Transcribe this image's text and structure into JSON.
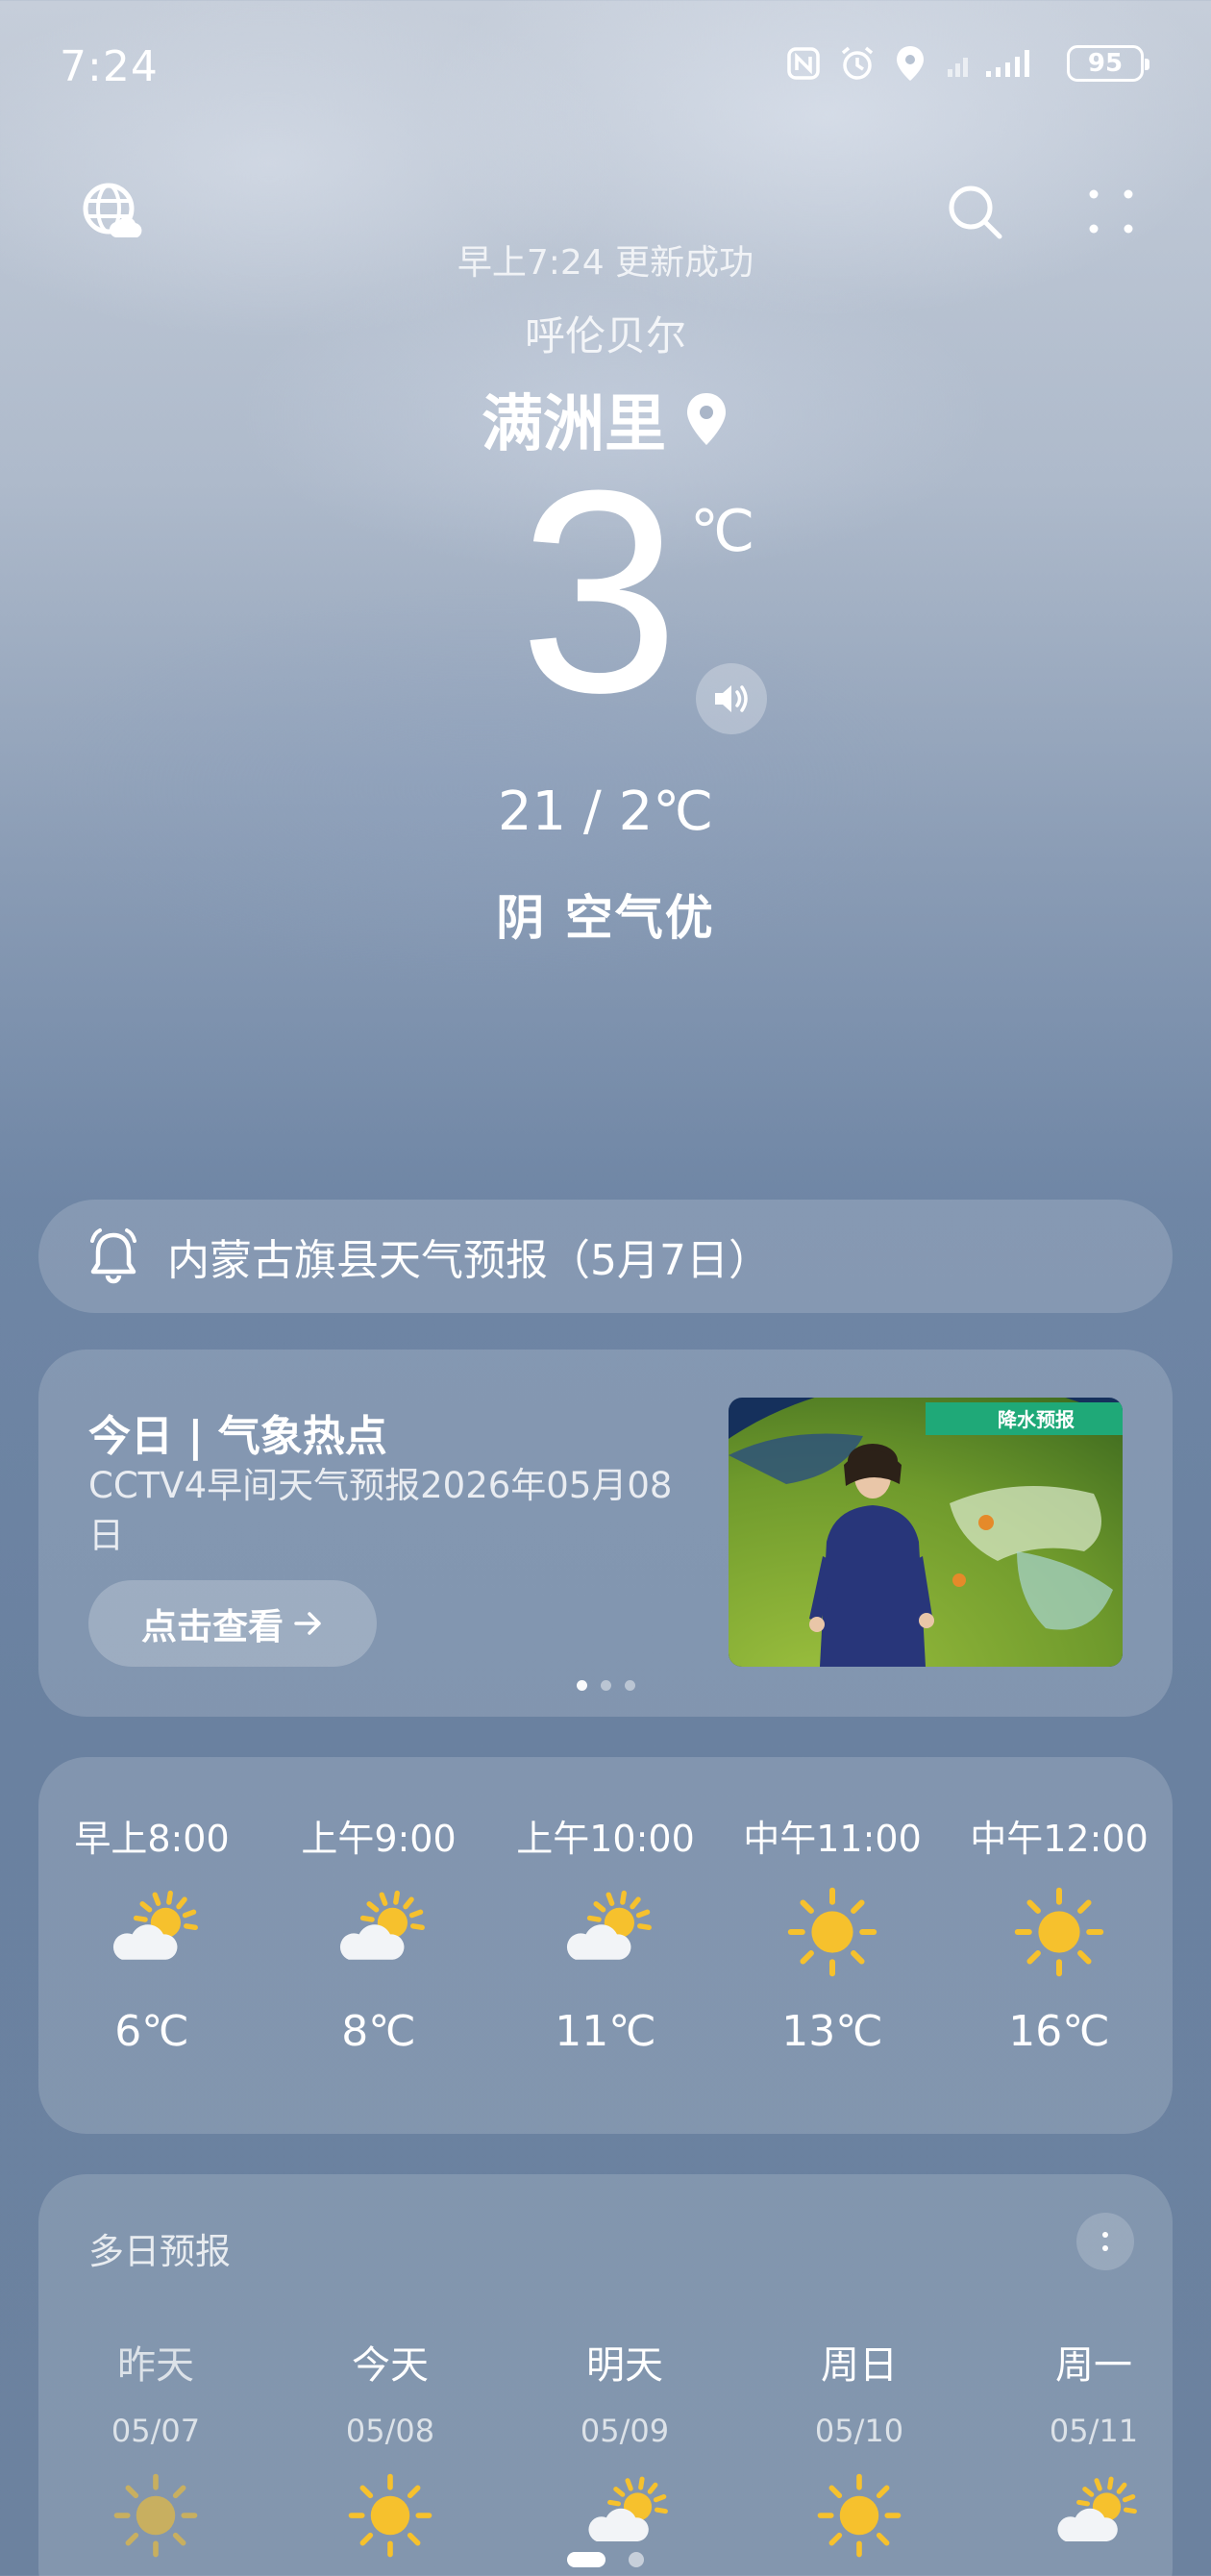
{
  "status_bar": {
    "time": "7:24",
    "battery": "95"
  },
  "header": {
    "update_text": "早上7:24 更新成功",
    "region": "呼伦贝尔",
    "city": "满洲里"
  },
  "current": {
    "temperature": "3",
    "unit": "℃",
    "range": "21 / 2℃",
    "condition": "阴  空气优"
  },
  "alert": {
    "text": "内蒙古旗县天气预报（5月7日）"
  },
  "hot_topic": {
    "title": "今日 | 气象热点",
    "subtitle": "CCTV4早间天气预报2026年05月08日",
    "button_label": "点击查看",
    "thumbnail_label": "降水预报",
    "page_count": 3,
    "active_page": 1
  },
  "hourly": [
    {
      "time": "早上8:00",
      "icon": "partly-cloudy-icon",
      "temp": "6℃"
    },
    {
      "time": "上午9:00",
      "icon": "partly-cloudy-icon",
      "temp": "8℃"
    },
    {
      "time": "上午10:00",
      "icon": "partly-cloudy-icon",
      "temp": "11℃"
    },
    {
      "time": "中午11:00",
      "icon": "sunny-icon",
      "temp": "13℃"
    },
    {
      "time": "中午12:00",
      "icon": "sunny-icon",
      "temp": "16℃"
    }
  ],
  "multi_day": {
    "title": "多日预报",
    "days": [
      {
        "name": "昨天",
        "date": "05/07",
        "icon": "sunny-icon"
      },
      {
        "name": "今天",
        "date": "05/08",
        "icon": "sunny-icon"
      },
      {
        "name": "明天",
        "date": "05/09",
        "icon": "partly-cloudy-icon"
      },
      {
        "name": "周日",
        "date": "05/10",
        "icon": "sunny-icon"
      },
      {
        "name": "周一",
        "date": "05/11",
        "icon": "partly-cloudy-icon"
      }
    ]
  },
  "colors": {
    "sun": "#f6c12d",
    "cloud": "#f2f4f7",
    "accent_green": "#2fb77e"
  }
}
